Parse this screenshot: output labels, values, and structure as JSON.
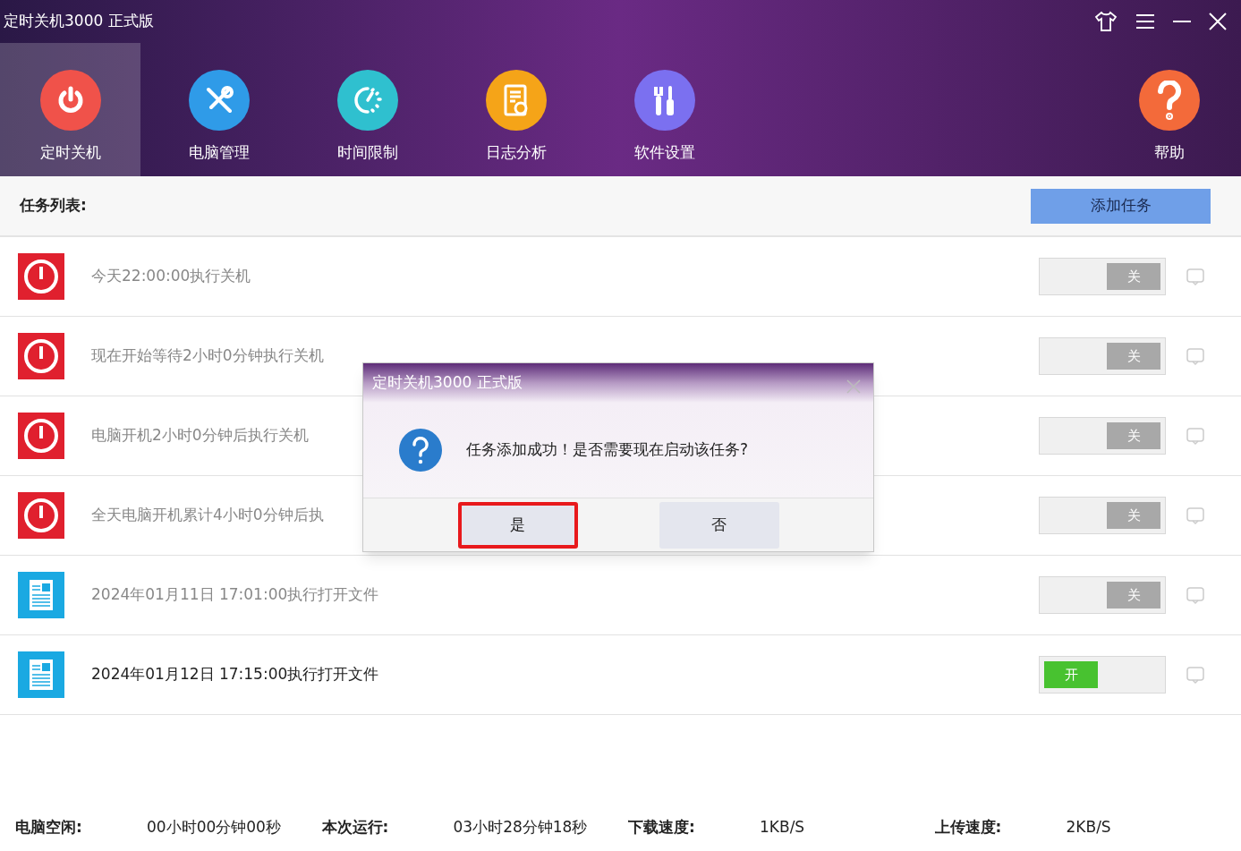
{
  "window": {
    "title": "定时关机3000 正式版"
  },
  "nav": [
    {
      "label": "定时关机",
      "selected": true
    },
    {
      "label": "电脑管理",
      "selected": false
    },
    {
      "label": "时间限制",
      "selected": false
    },
    {
      "label": "日志分析",
      "selected": false
    },
    {
      "label": "软件设置",
      "selected": false
    }
  ],
  "help": {
    "label": "帮助"
  },
  "task_header": {
    "title": "任务列表:",
    "add_button": "添加任务"
  },
  "tasks": [
    {
      "kind": "shutdown",
      "text": "今天22:00:00执行关机",
      "switch": "关",
      "on": false
    },
    {
      "kind": "shutdown",
      "text": "现在开始等待2小时0分钟执行关机",
      "switch": "关",
      "on": false
    },
    {
      "kind": "shutdown",
      "text": "电脑开机2小时0分钟后执行关机",
      "switch": "关",
      "on": false
    },
    {
      "kind": "shutdown",
      "text": "全天电脑开机累计4小时0分钟后执",
      "switch": "关",
      "on": false
    },
    {
      "kind": "file",
      "text": "2024年01月11日 17:01:00执行打开文件",
      "switch": "关",
      "on": false
    },
    {
      "kind": "file",
      "text": "2024年01月12日 17:15:00执行打开文件",
      "switch": "开",
      "on": true
    }
  ],
  "dialog": {
    "title": "定时关机3000 正式版",
    "message": "任务添加成功！是否需要现在启动该任务?",
    "buttons": [
      {
        "label": "是",
        "highlighted": true
      },
      {
        "label": "否",
        "highlighted": false
      }
    ]
  },
  "status_bar": [
    {
      "label": "电脑空闲:",
      "value": "00小时00分钟00秒"
    },
    {
      "label": "本次运行:",
      "value": "03小时28分钟18秒"
    },
    {
      "label": "下载速度:",
      "value": "1KB/S"
    },
    {
      "label": "上传速度:",
      "value": "2KB/S"
    }
  ]
}
